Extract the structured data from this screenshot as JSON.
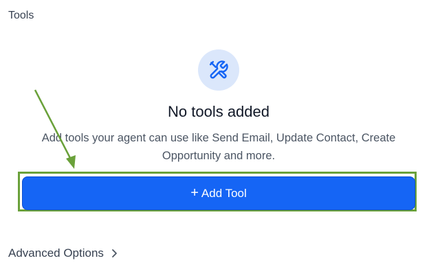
{
  "section": {
    "title": "Tools"
  },
  "empty_state": {
    "icon": "tools-icon",
    "title": "No tools added",
    "description": "Add tools your agent can use like Send Email, Update Contact, Create Opportunity and more."
  },
  "actions": {
    "add_tool_icon": "plus-icon",
    "add_tool_label": "Add Tool"
  },
  "advanced": {
    "label": "Advanced Options",
    "icon": "chevron-right-icon"
  },
  "annotation": {
    "color": "#6aa13a"
  },
  "colors": {
    "primary": "#1565f5",
    "icon_bg": "#dbe7fb"
  }
}
